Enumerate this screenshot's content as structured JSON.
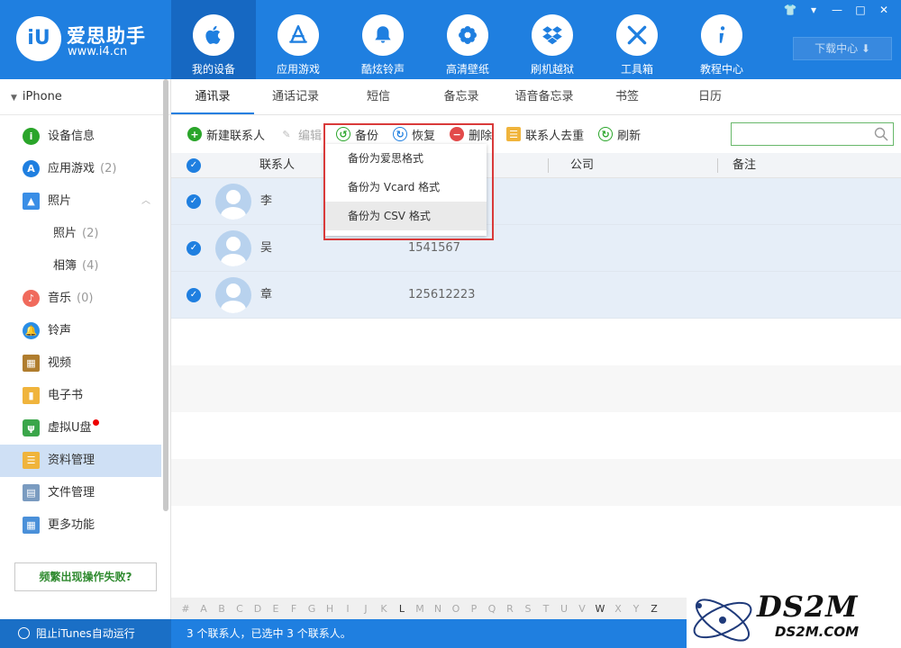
{
  "app": {
    "logo_mark": "iU",
    "name": "爱思助手",
    "url": "www.i4.cn"
  },
  "nav": [
    {
      "label": "我的设备",
      "icon": "apple-icon",
      "active": true
    },
    {
      "label": "应用游戏",
      "icon": "app-store-icon"
    },
    {
      "label": "酷炫铃声",
      "icon": "bell-icon"
    },
    {
      "label": "高清壁纸",
      "icon": "flower-icon"
    },
    {
      "label": "刷机越狱",
      "icon": "dropbox-icon"
    },
    {
      "label": "工具箱",
      "icon": "tools-icon"
    },
    {
      "label": "教程中心",
      "icon": "info-icon"
    }
  ],
  "download_label": "下载中心 ⬇",
  "window_controls": [
    "👕",
    "▾",
    "—",
    "□",
    "✕"
  ],
  "sidebar": {
    "device": "iPhone",
    "items": [
      {
        "label": "设备信息",
        "icon": "info-circle-icon",
        "color": "#2aa52a"
      },
      {
        "label": "应用游戏",
        "count": "(2)",
        "icon": "app-store-icon",
        "color": "#1f7fe0"
      },
      {
        "label": "照片",
        "icon": "photo-icon",
        "color": "#3a8ee6"
      },
      {
        "label": "照片",
        "count": "(2)",
        "sub": true
      },
      {
        "label": "相簿",
        "count": "(4)",
        "sub": true
      },
      {
        "label": "音乐",
        "count": "(0)",
        "icon": "music-icon",
        "color": "#f06a5c"
      },
      {
        "label": "铃声",
        "icon": "bell-icon",
        "color": "#2a8ee6"
      },
      {
        "label": "视频",
        "icon": "film-icon",
        "color": "#b07d2e"
      },
      {
        "label": "电子书",
        "icon": "book-icon",
        "color": "#f0b43c"
      },
      {
        "label": "虚拟U盘",
        "icon": "usb-icon",
        "color": "#3aa64a"
      },
      {
        "label": "资料管理",
        "icon": "contacts-icon",
        "color": "#f0b43c"
      },
      {
        "label": "文件管理",
        "icon": "file-icon",
        "color": "#7a9bc0"
      },
      {
        "label": "更多功能",
        "icon": "grid-icon",
        "color": "#4a90d9"
      }
    ],
    "fail_button": "频繁出现操作失败?"
  },
  "tabs": [
    "通讯录",
    "通话记录",
    "短信",
    "备忘录",
    "语音备忘录",
    "书签",
    "日历"
  ],
  "toolbar": {
    "new_contact": "新建联系人",
    "edit": "编辑",
    "backup": "备份",
    "restore": "恢复",
    "delete": "删除",
    "dedupe": "联系人去重",
    "refresh": "刷新",
    "search_placeholder": ""
  },
  "table": {
    "headers": [
      "联系人",
      "公司",
      "备注"
    ],
    "rows": [
      {
        "name": "李",
        "phone": ""
      },
      {
        "name": "吴",
        "phone": "1541567"
      },
      {
        "name": "章",
        "phone": "125612223"
      }
    ]
  },
  "dropdown": [
    "备份为爱思格式",
    "备份为 Vcard 格式",
    "备份为 CSV 格式"
  ],
  "alphabet": [
    "#",
    "A",
    "B",
    "C",
    "D",
    "E",
    "F",
    "G",
    "H",
    "I",
    "J",
    "K",
    "L",
    "M",
    "N",
    "O",
    "P",
    "Q",
    "R",
    "S",
    "T",
    "U",
    "V",
    "W",
    "X",
    "Y",
    "Z"
  ],
  "status": {
    "itunes": "阻止iTunes自动运行",
    "message": "3 个联系人，已选中 3 个联系人。"
  },
  "watermark": {
    "title": "DS2M",
    "sub": "DS2M.COM"
  }
}
